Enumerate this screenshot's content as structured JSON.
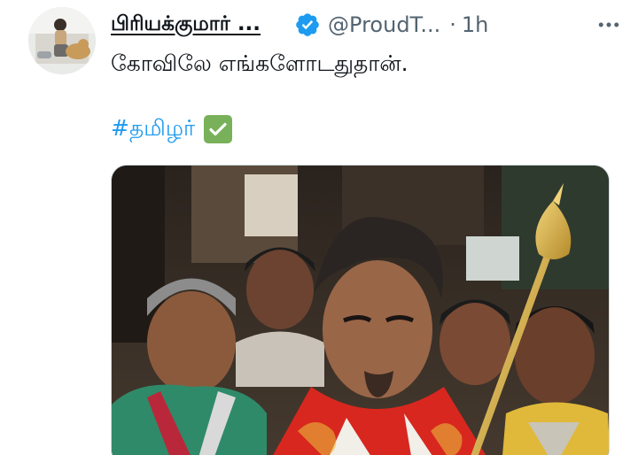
{
  "tweet": {
    "display_name": "பிரியக்குமார் ...",
    "handle": "@ProudT...",
    "separator": "·",
    "time": "1h",
    "text": "கோவிலே எங்களோடதுதான்.",
    "hashtag": "#தமிழர்",
    "emoji": "check-mark-button",
    "verified": true
  },
  "colors": {
    "link": "#1d9bf0",
    "verified_badge": "#1d9bf0",
    "text": "#0f1419",
    "secondary": "#536471",
    "check_emoji": "#78b159"
  },
  "icons": {
    "avatar": "profile-photo",
    "verified": "verified-badge-icon",
    "more": "more-icon",
    "check": "check-mark-emoji-icon",
    "media": "photo-man-in-red-shawl-temple-crowd"
  }
}
